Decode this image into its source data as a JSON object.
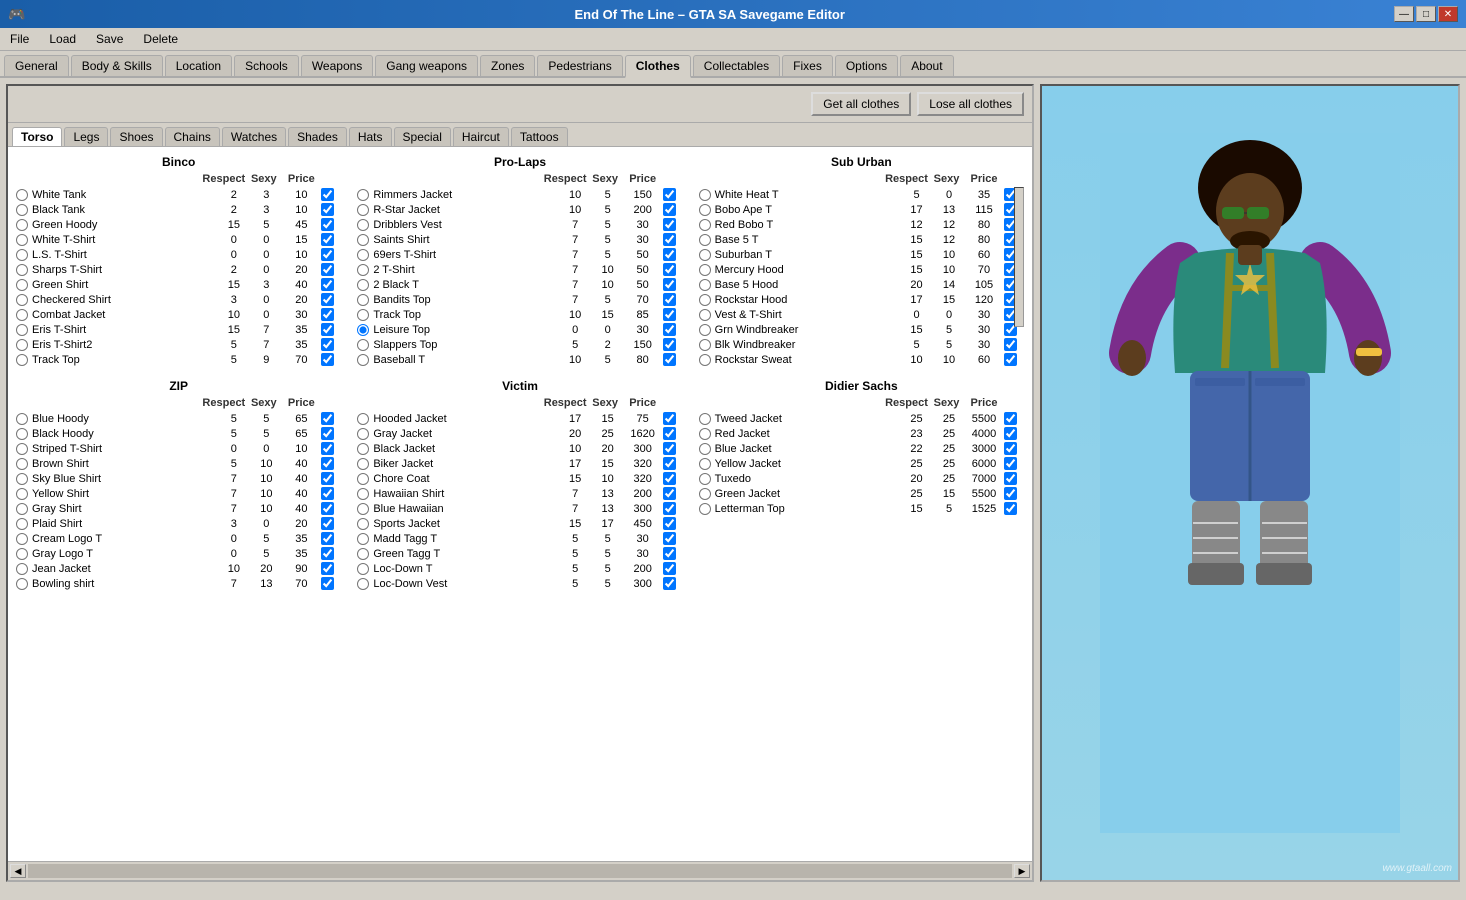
{
  "window": {
    "title": "End Of The Line – GTA SA Savegame Editor",
    "icon": "🎮"
  },
  "winControls": {
    "minimize": "—",
    "maximize": "□",
    "close": "✕"
  },
  "menu": [
    "File",
    "Load",
    "Save",
    "Delete"
  ],
  "mainTabs": [
    {
      "label": "General",
      "active": false
    },
    {
      "label": "Body & Skills",
      "active": false
    },
    {
      "label": "Location",
      "active": false
    },
    {
      "label": "Schools",
      "active": false
    },
    {
      "label": "Weapons",
      "active": false
    },
    {
      "label": "Gang weapons",
      "active": false
    },
    {
      "label": "Zones",
      "active": false
    },
    {
      "label": "Pedestrians",
      "active": false
    },
    {
      "label": "Clothes",
      "active": true
    },
    {
      "label": "Collectables",
      "active": false
    },
    {
      "label": "Fixes",
      "active": false
    },
    {
      "label": "Options",
      "active": false
    },
    {
      "label": "About",
      "active": false
    }
  ],
  "clothesBtns": {
    "getAllClothes": "Get all clothes",
    "loseAllClothes": "Lose all clothes"
  },
  "subTabs": [
    "Torso",
    "Legs",
    "Shoes",
    "Chains",
    "Watches",
    "Shades",
    "Hats",
    "Special",
    "Haircut",
    "Tattoos"
  ],
  "activeSubTab": "Torso",
  "columns": {
    "name": "",
    "respect": "Respect",
    "sexy": "Sexy",
    "price": "Price",
    "check": ""
  },
  "sections": {
    "binco": {
      "title": "Binco",
      "items": [
        {
          "name": "White Tank",
          "respect": 2,
          "sexy": 3,
          "price": 10,
          "checked": true,
          "radio": false
        },
        {
          "name": "Black Tank",
          "respect": 2,
          "sexy": 3,
          "price": 10,
          "checked": true,
          "radio": false
        },
        {
          "name": "Green Hoody",
          "respect": 15,
          "sexy": 5,
          "price": 45,
          "checked": true,
          "radio": false
        },
        {
          "name": "White T-Shirt",
          "respect": 0,
          "sexy": 0,
          "price": 15,
          "checked": true,
          "radio": false
        },
        {
          "name": "L.S. T-Shirt",
          "respect": 0,
          "sexy": 0,
          "price": 10,
          "checked": true,
          "radio": false
        },
        {
          "name": "Sharps T-Shirt",
          "respect": 2,
          "sexy": 0,
          "price": 20,
          "checked": true,
          "radio": false
        },
        {
          "name": "Green Shirt",
          "respect": 15,
          "sexy": 3,
          "price": 40,
          "checked": true,
          "radio": false
        },
        {
          "name": "Checkered Shirt",
          "respect": 3,
          "sexy": 0,
          "price": 20,
          "checked": true,
          "radio": false
        },
        {
          "name": "Combat Jacket",
          "respect": 10,
          "sexy": 0,
          "price": 30,
          "checked": true,
          "radio": false
        },
        {
          "name": "Eris T-Shirt",
          "respect": 15,
          "sexy": 7,
          "price": 35,
          "checked": true,
          "radio": false
        },
        {
          "name": "Eris T-Shirt2",
          "respect": 5,
          "sexy": 7,
          "price": 35,
          "checked": true,
          "radio": false
        },
        {
          "name": "Track Top",
          "respect": 5,
          "sexy": 9,
          "price": 70,
          "checked": true,
          "radio": false
        }
      ]
    },
    "proLaps": {
      "title": "Pro-Laps",
      "items": [
        {
          "name": "Rimmers Jacket",
          "respect": 10,
          "sexy": 5,
          "price": 150,
          "checked": true,
          "radio": false
        },
        {
          "name": "R-Star Jacket",
          "respect": 10,
          "sexy": 5,
          "price": 200,
          "checked": true,
          "radio": false
        },
        {
          "name": "Dribblers Vest",
          "respect": 7,
          "sexy": 5,
          "price": 30,
          "checked": true,
          "radio": false
        },
        {
          "name": "Saints Shirt",
          "respect": 7,
          "sexy": 5,
          "price": 30,
          "checked": true,
          "radio": false
        },
        {
          "name": "69ers T-Shirt",
          "respect": 7,
          "sexy": 5,
          "price": 50,
          "checked": true,
          "radio": false
        },
        {
          "name": "2 T-Shirt",
          "respect": 7,
          "sexy": 10,
          "price": 50,
          "checked": true,
          "radio": false
        },
        {
          "name": "2 Black T",
          "respect": 7,
          "sexy": 10,
          "price": 50,
          "checked": true,
          "radio": false
        },
        {
          "name": "Bandits Top",
          "respect": 7,
          "sexy": 5,
          "price": 70,
          "checked": true,
          "radio": false
        },
        {
          "name": "Track Top",
          "respect": 10,
          "sexy": 15,
          "price": 85,
          "checked": true,
          "radio": false
        },
        {
          "name": "Leisure Top",
          "respect": 0,
          "sexy": 0,
          "price": 30,
          "checked": true,
          "radio": true
        },
        {
          "name": "Slappers Top",
          "respect": 5,
          "sexy": 2,
          "price": 150,
          "checked": true,
          "radio": false
        },
        {
          "name": "Baseball T",
          "respect": 10,
          "sexy": 5,
          "price": 80,
          "checked": true,
          "radio": false
        }
      ]
    },
    "subUrban": {
      "title": "Sub Urban",
      "items": [
        {
          "name": "White Heat T",
          "respect": 5,
          "sexy": 0,
          "price": 35,
          "checked": true,
          "radio": false
        },
        {
          "name": "Bobo Ape T",
          "respect": 17,
          "sexy": 13,
          "price": 115,
          "checked": true,
          "radio": false
        },
        {
          "name": "Red Bobo T",
          "respect": 12,
          "sexy": 12,
          "price": 80,
          "checked": true,
          "radio": false
        },
        {
          "name": "Base 5 T",
          "respect": 15,
          "sexy": 12,
          "price": 80,
          "checked": true,
          "radio": false
        },
        {
          "name": "Suburban T",
          "respect": 15,
          "sexy": 10,
          "price": 60,
          "checked": true,
          "radio": false
        },
        {
          "name": "Mercury Hood",
          "respect": 15,
          "sexy": 10,
          "price": 70,
          "checked": true,
          "radio": false
        },
        {
          "name": "Base 5 Hood",
          "respect": 20,
          "sexy": 14,
          "price": 105,
          "checked": true,
          "radio": false
        },
        {
          "name": "Rockstar Hood",
          "respect": 17,
          "sexy": 15,
          "price": 120,
          "checked": true,
          "radio": false
        },
        {
          "name": "Vest & T-Shirt",
          "respect": 0,
          "sexy": 0,
          "price": 30,
          "checked": true,
          "radio": false
        },
        {
          "name": "Grn Windbreaker",
          "respect": 15,
          "sexy": 5,
          "price": 30,
          "checked": true,
          "radio": false
        },
        {
          "name": "Blk Windbreaker",
          "respect": 5,
          "sexy": 5,
          "price": 30,
          "checked": true,
          "radio": false
        },
        {
          "name": "Rockstar Sweat",
          "respect": 10,
          "sexy": 10,
          "price": 60,
          "checked": true,
          "radio": false
        }
      ]
    },
    "zip": {
      "title": "ZIP",
      "items": [
        {
          "name": "Blue Hoody",
          "respect": 5,
          "sexy": 5,
          "price": 65,
          "checked": true,
          "radio": false
        },
        {
          "name": "Black Hoody",
          "respect": 5,
          "sexy": 5,
          "price": 65,
          "checked": true,
          "radio": false
        },
        {
          "name": "Striped T-Shirt",
          "respect": 0,
          "sexy": 0,
          "price": 10,
          "checked": true,
          "radio": false
        },
        {
          "name": "Brown Shirt",
          "respect": 5,
          "sexy": 10,
          "price": 40,
          "checked": true,
          "radio": false
        },
        {
          "name": "Sky Blue Shirt",
          "respect": 7,
          "sexy": 10,
          "price": 40,
          "checked": true,
          "radio": false
        },
        {
          "name": "Yellow Shirt",
          "respect": 7,
          "sexy": 10,
          "price": 40,
          "checked": true,
          "radio": false
        },
        {
          "name": "Gray Shirt",
          "respect": 7,
          "sexy": 10,
          "price": 40,
          "checked": true,
          "radio": false
        },
        {
          "name": "Plaid Shirt",
          "respect": 3,
          "sexy": 0,
          "price": 20,
          "checked": true,
          "radio": false
        },
        {
          "name": "Cream Logo T",
          "respect": 0,
          "sexy": 5,
          "price": 35,
          "checked": true,
          "radio": false
        },
        {
          "name": "Gray Logo T",
          "respect": 0,
          "sexy": 5,
          "price": 35,
          "checked": true,
          "radio": false
        },
        {
          "name": "Jean Jacket",
          "respect": 10,
          "sexy": 20,
          "price": 90,
          "checked": true,
          "radio": false
        },
        {
          "name": "Bowling shirt",
          "respect": 7,
          "sexy": 13,
          "price": 70,
          "checked": true,
          "radio": false
        }
      ]
    },
    "victim": {
      "title": "Victim",
      "items": [
        {
          "name": "Hooded Jacket",
          "respect": 17,
          "sexy": 15,
          "price": 75,
          "checked": true,
          "radio": false
        },
        {
          "name": "Gray Jacket",
          "respect": 20,
          "sexy": 25,
          "price": 1620,
          "checked": true,
          "radio": false
        },
        {
          "name": "Black Jacket",
          "respect": 10,
          "sexy": 20,
          "price": 300,
          "checked": true,
          "radio": false
        },
        {
          "name": "Biker Jacket",
          "respect": 17,
          "sexy": 15,
          "price": 320,
          "checked": true,
          "radio": false
        },
        {
          "name": "Chore Coat",
          "respect": 15,
          "sexy": 10,
          "price": 320,
          "checked": true,
          "radio": false
        },
        {
          "name": "Hawaiian Shirt",
          "respect": 7,
          "sexy": 13,
          "price": 200,
          "checked": true,
          "radio": false
        },
        {
          "name": "Blue Hawaiian",
          "respect": 7,
          "sexy": 13,
          "price": 300,
          "checked": true,
          "radio": false
        },
        {
          "name": "Sports Jacket",
          "respect": 15,
          "sexy": 17,
          "price": 450,
          "checked": true,
          "radio": false
        },
        {
          "name": "Madd Tagg T",
          "respect": 5,
          "sexy": 5,
          "price": 30,
          "checked": true,
          "radio": false
        },
        {
          "name": "Green Tagg T",
          "respect": 5,
          "sexy": 5,
          "price": 30,
          "checked": true,
          "radio": false
        },
        {
          "name": "Loc-Down T",
          "respect": 5,
          "sexy": 5,
          "price": 200,
          "checked": true,
          "radio": false
        },
        {
          "name": "Loc-Down Vest",
          "respect": 5,
          "sexy": 5,
          "price": 300,
          "checked": true,
          "radio": false
        }
      ]
    },
    "didierSachs": {
      "title": "Didier Sachs",
      "items": [
        {
          "name": "Tweed Jacket",
          "respect": 25,
          "sexy": 25,
          "price": 5500,
          "checked": true,
          "radio": false
        },
        {
          "name": "Red Jacket",
          "respect": 23,
          "sexy": 25,
          "price": 4000,
          "checked": true,
          "radio": false
        },
        {
          "name": "Blue Jacket",
          "respect": 22,
          "sexy": 25,
          "price": 3000,
          "checked": true,
          "radio": false
        },
        {
          "name": "Yellow Jacket",
          "respect": 25,
          "sexy": 25,
          "price": 6000,
          "checked": true,
          "radio": false
        },
        {
          "name": "Tuxedo",
          "respect": 20,
          "sexy": 25,
          "price": 7000,
          "checked": true,
          "radio": false
        },
        {
          "name": "Green Jacket",
          "respect": 25,
          "sexy": 15,
          "price": 5500,
          "checked": true,
          "radio": false
        },
        {
          "name": "Letterman Top",
          "respect": 15,
          "sexy": 5,
          "price": 1525,
          "checked": true,
          "radio": false
        }
      ]
    }
  }
}
